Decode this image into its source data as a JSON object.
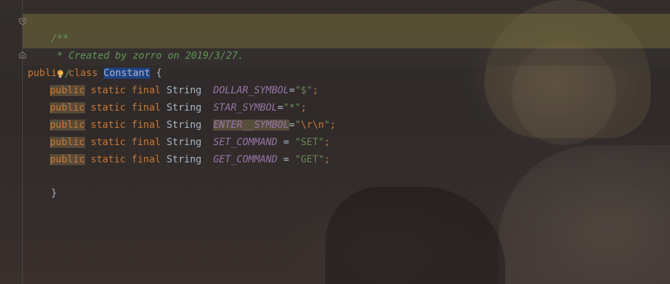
{
  "editor": {
    "comment_open": "/**",
    "comment_body": " * Created by zorro on 2019/3/27.",
    "comment_close": "/",
    "class_decl": {
      "kw_public": "public",
      "kw_class": "class",
      "name": "Constant",
      "brace": "{"
    },
    "fields": [
      {
        "mod_public": "public",
        "mod_static": "static",
        "mod_final": "final",
        "type": "String",
        "name": "DOLLAR_SYMBOL",
        "assign": "=",
        "str_open": "\"",
        "value": "$",
        "str_close": "\"",
        "end": ";"
      },
      {
        "mod_public": "public",
        "mod_static": "static",
        "mod_final": "final",
        "type": "String",
        "name": "STAR_SYMBOL",
        "assign": "=",
        "str_open": "\"",
        "value": "*",
        "str_close": "\"",
        "end": ";"
      },
      {
        "mod_public": "public",
        "mod_static": "static",
        "mod_final": "final",
        "type": "String",
        "name": "ENTER__SYMBOL",
        "assign": "=",
        "str_open": "\"",
        "value": "\\r\\n",
        "str_close": "\"",
        "end": ";"
      },
      {
        "mod_public": "public",
        "mod_static": "static",
        "mod_final": "final",
        "type": "String",
        "name": "SET_COMMAND",
        "assign": " = ",
        "str_open": "\"",
        "value": "SET",
        "str_close": "\"",
        "end": ";"
      },
      {
        "mod_public": "public",
        "mod_static": "static",
        "mod_final": "final",
        "type": "String",
        "name": "GET_COMMAND",
        "assign": " = ",
        "str_open": "\"",
        "value": "GET",
        "str_close": "\"",
        "end": ";"
      }
    ],
    "closing_brace": "}"
  },
  "icons": {
    "intention_bulb": "lightbulb-icon",
    "fold_start": "fold-start-icon",
    "fold_end": "fold-end-icon"
  },
  "colors": {
    "keyword": "#cc7832",
    "comment": "#629755",
    "field": "#9876aa",
    "string": "#6a8759",
    "selection": "#214283",
    "comment_band": "#736c3c"
  }
}
